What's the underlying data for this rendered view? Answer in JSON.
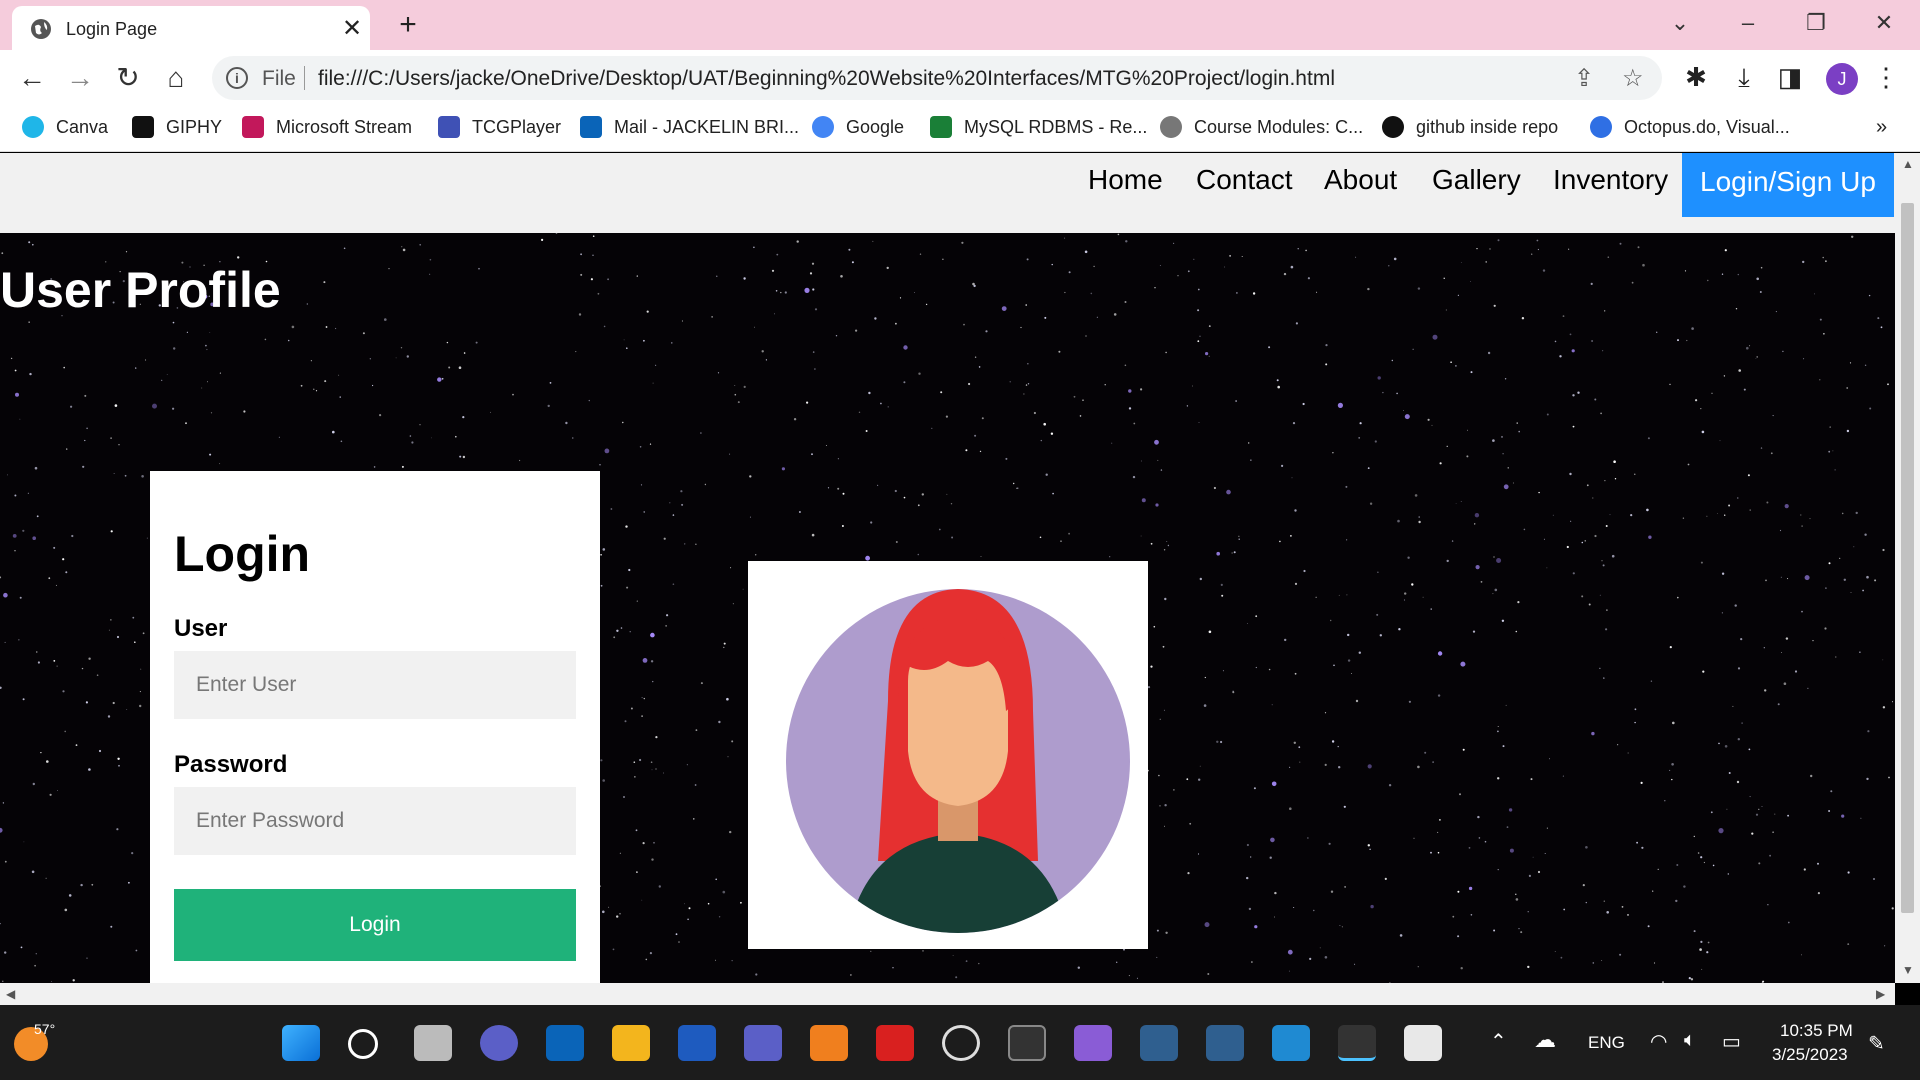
{
  "browser": {
    "tab_title": "Login Page",
    "url_scheme": "File",
    "url": "file:///C:/Users/jacke/OneDrive/Desktop/UAT/Beginning%20Website%20Interfaces/MTG%20Project/login.html",
    "profile_initial": "J",
    "bookmarks": [
      {
        "label": "Canva",
        "color": "#1fb6e8"
      },
      {
        "label": "GIPHY",
        "color": "#111111"
      },
      {
        "label": "Microsoft Stream",
        "color": "#c2185b"
      },
      {
        "label": "TCGPlayer",
        "color": "#3f51b5"
      },
      {
        "label": "Mail - JACKELIN BRI...",
        "color": "#0a64b8"
      },
      {
        "label": "Google",
        "color": "#4285f4"
      },
      {
        "label": "MySQL RDBMS - Re...",
        "color": "#1a7f37"
      },
      {
        "label": "Course Modules: C...",
        "color": "#777777"
      },
      {
        "label": "github inside repo",
        "color": "#111111"
      },
      {
        "label": "Octopus.do, Visual...",
        "color": "#2f6fe4"
      }
    ]
  },
  "site": {
    "nav": [
      "Home",
      "Contact",
      "About",
      "Gallery",
      "Inventory"
    ],
    "nav_active": "Login/Sign Up",
    "page_title": "User Profile",
    "login": {
      "heading": "Login",
      "user_label": "User",
      "user_placeholder": "Enter User",
      "password_label": "Password",
      "password_placeholder": "Enter Password",
      "button": "Login"
    }
  },
  "taskbar": {
    "weather_temp": "57°",
    "language": "ENG",
    "time": "10:35 PM",
    "date": "3/25/2023"
  },
  "colors": {
    "tabbar": "#f5ccdc",
    "nav_active": "#1e90ff",
    "login_button": "#1fb27a",
    "avatar_circle": "#ae9ccd",
    "hair": "#e53030",
    "skin": "#f4b98a",
    "shirt": "#173f36"
  }
}
